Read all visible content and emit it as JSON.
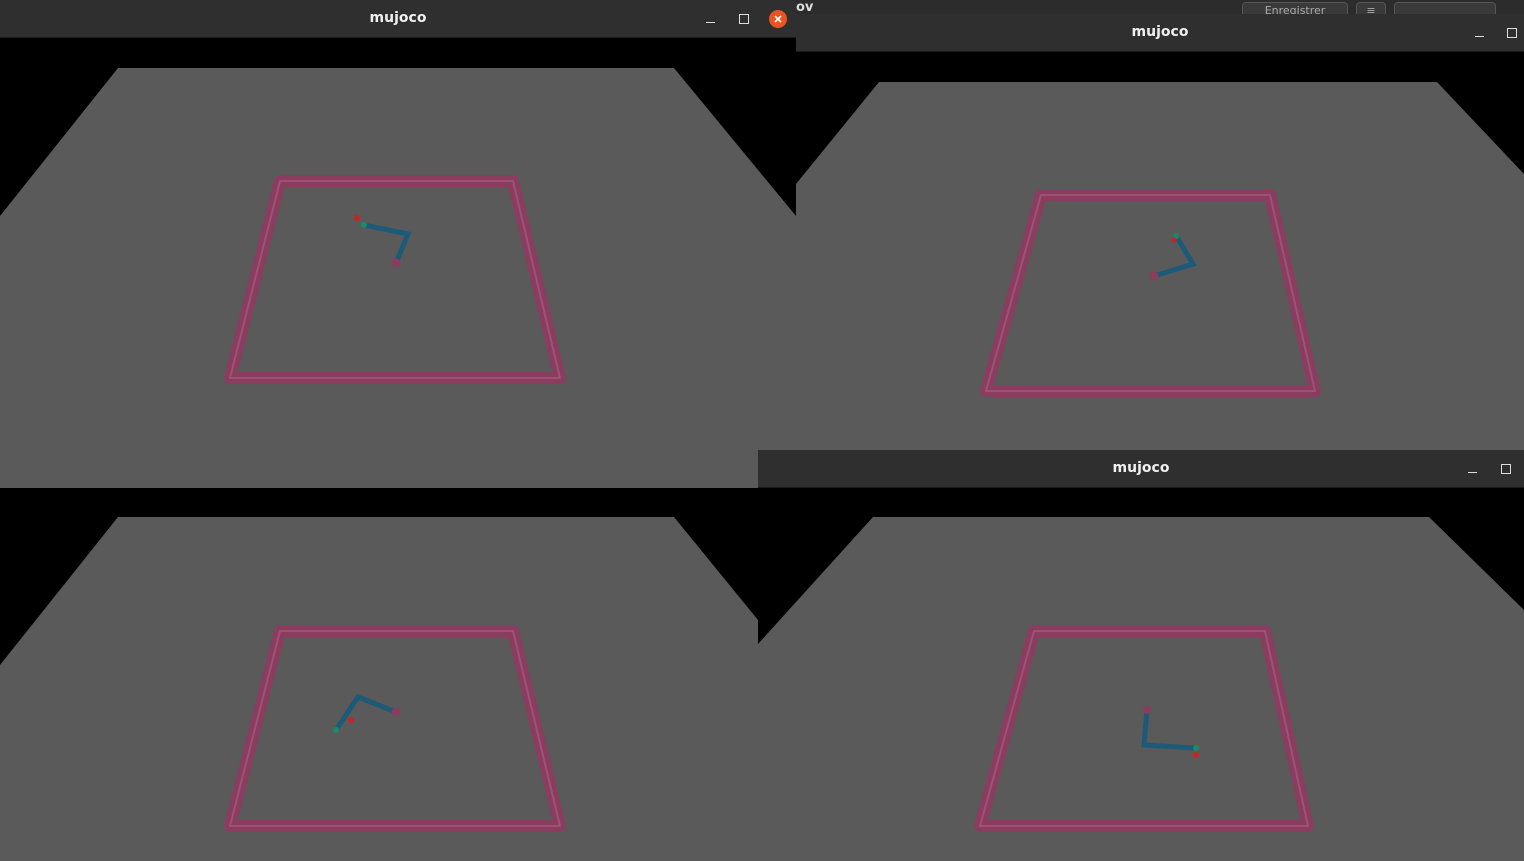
{
  "background_window": {
    "title_fragment": "ov",
    "button_label": "Enregistrer",
    "icons": [
      "menu-icon",
      "minimize-icon",
      "close-icon"
    ]
  },
  "windows": [
    {
      "title": "mujoco",
      "has_close": true,
      "controls": [
        "minimize-icon",
        "maximize-icon",
        "close-icon"
      ]
    },
    {
      "title": "mujoco",
      "has_close": false,
      "controls": [
        "minimize-icon",
        "maximize-icon"
      ]
    },
    {
      "title": "mujoco",
      "has_close": false,
      "controls": [
        "minimize-icon",
        "maximize-icon"
      ]
    },
    {
      "title": "",
      "has_close": false,
      "controls": []
    }
  ],
  "colors": {
    "floor": "#5a5a5a",
    "arena_wall": "#8a3d5e",
    "arm_link": "#1c5a78",
    "target": "#cc2222",
    "fingertip": "#1a8a6a",
    "titlebar": "#2f2f2f",
    "close_button": "#e95420"
  }
}
